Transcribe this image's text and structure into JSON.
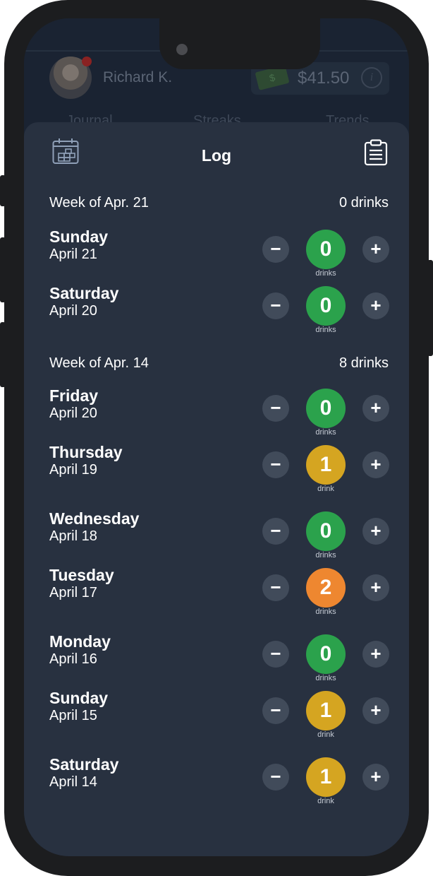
{
  "header": {
    "username": "Richard K.",
    "balance": "$41.50",
    "tabs": [
      "Journal",
      "Streaks",
      "Trends"
    ]
  },
  "sheet": {
    "title": "Log"
  },
  "weeks": [
    {
      "label": "Week of Apr. 21",
      "total": "0 drinks",
      "days": [
        {
          "name": "Sunday",
          "date": "April 21",
          "count": "0",
          "unit": "drinks"
        },
        {
          "name": "Saturday",
          "date": "April 20",
          "count": "0",
          "unit": "drinks"
        }
      ]
    },
    {
      "label": "Week of Apr. 14",
      "total": "8 drinks",
      "days": [
        {
          "name": "Friday",
          "date": "April 20",
          "count": "0",
          "unit": "drinks"
        },
        {
          "name": "Thursday",
          "date": "April 19",
          "count": "1",
          "unit": "drink"
        },
        {
          "name": "Wednesday",
          "date": "April 18",
          "count": "0",
          "unit": "drinks"
        },
        {
          "name": "Tuesday",
          "date": "April 17",
          "count": "2",
          "unit": "drinks"
        },
        {
          "name": "Monday",
          "date": "April 16",
          "count": "0",
          "unit": "drinks"
        },
        {
          "name": "Sunday",
          "date": "April 15",
          "count": "1",
          "unit": "drink"
        },
        {
          "name": "Saturday",
          "date": "April 14",
          "count": "1",
          "unit": "drink"
        }
      ]
    }
  ],
  "controls": {
    "minus": "−",
    "plus": "+"
  },
  "colors": {
    "zero": "#2ba24c",
    "one": "#d5a521",
    "two": "#ee8730",
    "sheet_bg": "#283140",
    "stepper_bg": "#414b5a"
  }
}
